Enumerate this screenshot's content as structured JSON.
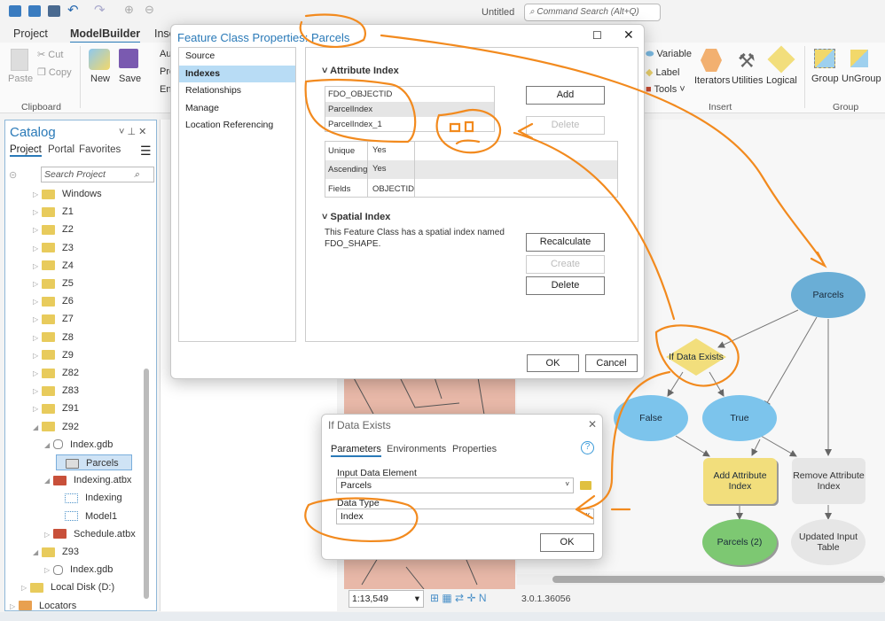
{
  "titlebar": {
    "title": "Untitled",
    "search_placeholder": "Command Search (Alt+Q)"
  },
  "ribbon": {
    "tabs": [
      {
        "label": "Project"
      },
      {
        "label": "ModelBuilder",
        "active": true
      },
      {
        "label": "Inse"
      }
    ],
    "clipboard": {
      "paste": "Paste",
      "cut": "Cut",
      "copy": "Copy",
      "group_label": "Clipboard"
    },
    "model": {
      "new": "New",
      "save": "Save",
      "auto": "Au",
      "pro": "Pro",
      "env": "Env"
    },
    "insert": {
      "variable": "Variable",
      "label": "Label",
      "tools": "Tools",
      "iterators": "Iterators",
      "utilities": "Utilities",
      "logical": "Logical",
      "group_label": "Insert"
    },
    "group": {
      "group": "Group",
      "ungroup": "UnGroup",
      "group_label": "Group"
    }
  },
  "catalog": {
    "title": "Catalog",
    "tabs": [
      "Project",
      "Portal",
      "Favorites"
    ],
    "search_placeholder": "Search Project",
    "items": [
      {
        "label": "Windows",
        "level": 1,
        "type": "folder"
      },
      {
        "label": "Z1",
        "level": 1,
        "type": "folder"
      },
      {
        "label": "Z2",
        "level": 1,
        "type": "folder"
      },
      {
        "label": "Z3",
        "level": 1,
        "type": "folder"
      },
      {
        "label": "Z4",
        "level": 1,
        "type": "folder"
      },
      {
        "label": "Z5",
        "level": 1,
        "type": "folder"
      },
      {
        "label": "Z6",
        "level": 1,
        "type": "folder"
      },
      {
        "label": "Z7",
        "level": 1,
        "type": "folder"
      },
      {
        "label": "Z8",
        "level": 1,
        "type": "folder"
      },
      {
        "label": "Z9",
        "level": 1,
        "type": "folder"
      },
      {
        "label": "Z82",
        "level": 1,
        "type": "folder"
      },
      {
        "label": "Z83",
        "level": 1,
        "type": "folder"
      },
      {
        "label": "Z91",
        "level": 1,
        "type": "folder"
      },
      {
        "label": "Z92",
        "level": 1,
        "type": "folder",
        "expanded": true
      },
      {
        "label": "Index.gdb",
        "level": 2,
        "type": "gdb",
        "expanded": true
      },
      {
        "label": "Parcels",
        "level": 3,
        "type": "featureclass",
        "selected": true
      },
      {
        "label": "Indexing.atbx",
        "level": 2,
        "type": "toolbox",
        "expanded": true
      },
      {
        "label": "Indexing",
        "level": 3,
        "type": "model"
      },
      {
        "label": "Model1",
        "level": 3,
        "type": "model"
      },
      {
        "label": "Schedule.atbx",
        "level": 2,
        "type": "toolbox"
      },
      {
        "label": "Z93",
        "level": 1,
        "type": "folder",
        "expanded": true
      },
      {
        "label": "Index.gdb",
        "level": 2,
        "type": "gdb"
      },
      {
        "label": "Local Disk (D:)",
        "level": 0,
        "type": "folder"
      },
      {
        "label": "Locators",
        "level": -1,
        "type": "locator"
      }
    ]
  },
  "fc_dialog": {
    "title": "Feature Class Properties: Parcels",
    "nav": [
      {
        "label": "Source"
      },
      {
        "label": "Indexes",
        "active": true
      },
      {
        "label": "Relationships"
      },
      {
        "label": "Manage"
      },
      {
        "label": "Location Referencing"
      }
    ],
    "attr_heading": "Attribute Index",
    "indexes": [
      "FDO_OBJECTID",
      "ParcelIndex",
      "ParcelIndex_1"
    ],
    "add": "Add",
    "delete": "Delete",
    "props": [
      {
        "k": "Unique",
        "v": "Yes"
      },
      {
        "k": "Ascending",
        "v": "Yes"
      },
      {
        "k": "Fields",
        "v": "OBJECTID"
      }
    ],
    "spatial_heading": "Spatial Index",
    "spatial_text": "This Feature Class has a spatial index named FDO_SHAPE.",
    "recalculate": "Recalculate",
    "create": "Create",
    "delete2": "Delete",
    "ok": "OK",
    "cancel": "Cancel"
  },
  "ide_dialog": {
    "title": "If Data Exists",
    "tabs": [
      "Parameters",
      "Environments",
      "Properties"
    ],
    "input_label": "Input Data Element",
    "input_value": "Parcels",
    "type_label": "Data Type",
    "type_value": "Index",
    "ok": "OK"
  },
  "map": {
    "scale": "1:13,549"
  },
  "status": {
    "version": "3.0.1.36056"
  },
  "model": {
    "nodes": {
      "parcels": "Parcels",
      "ifexists": "If Data Exists",
      "false": "False",
      "true": "True",
      "add": "Add Attribute Index",
      "remove": "Remove Attribute Index",
      "parcels2": "Parcels (2)",
      "updated": "Updated Input Table"
    },
    "colors": {
      "input": "#6aaed6",
      "logical": "#f2de7c",
      "bool": "#7cc4ec",
      "tool": "#f2de7c",
      "tool_disabled": "#e6e6e6",
      "output": "#7dc872",
      "output_disabled": "#e6e6e6"
    }
  },
  "annotation_color": "#f28a1e"
}
